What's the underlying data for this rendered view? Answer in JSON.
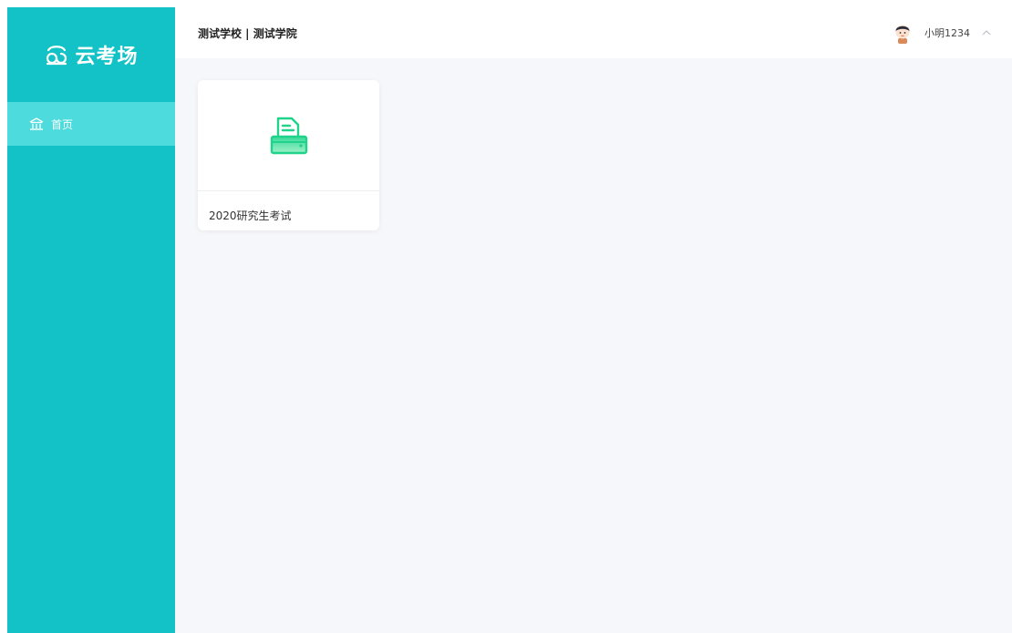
{
  "sidebar": {
    "logo_text": "云考场",
    "logo_icon": "cloud-logo-icon",
    "items": [
      {
        "label": "首页",
        "icon": "home-icon",
        "active": true
      }
    ]
  },
  "header": {
    "title": "测试学校 | 测试学院",
    "user": {
      "name": "小明1234",
      "avatar_icon": "avatar-icon",
      "toggle_icon": "chevron-up-icon"
    }
  },
  "main": {
    "cards": [
      {
        "title": "2020研究生考试",
        "icon": "printer-icon"
      }
    ]
  },
  "colors": {
    "sidebar": "#13c2c6",
    "sidebar_active": "#4ddbdd",
    "accent_green": "#1fd38a",
    "background": "#f6f7fb"
  }
}
